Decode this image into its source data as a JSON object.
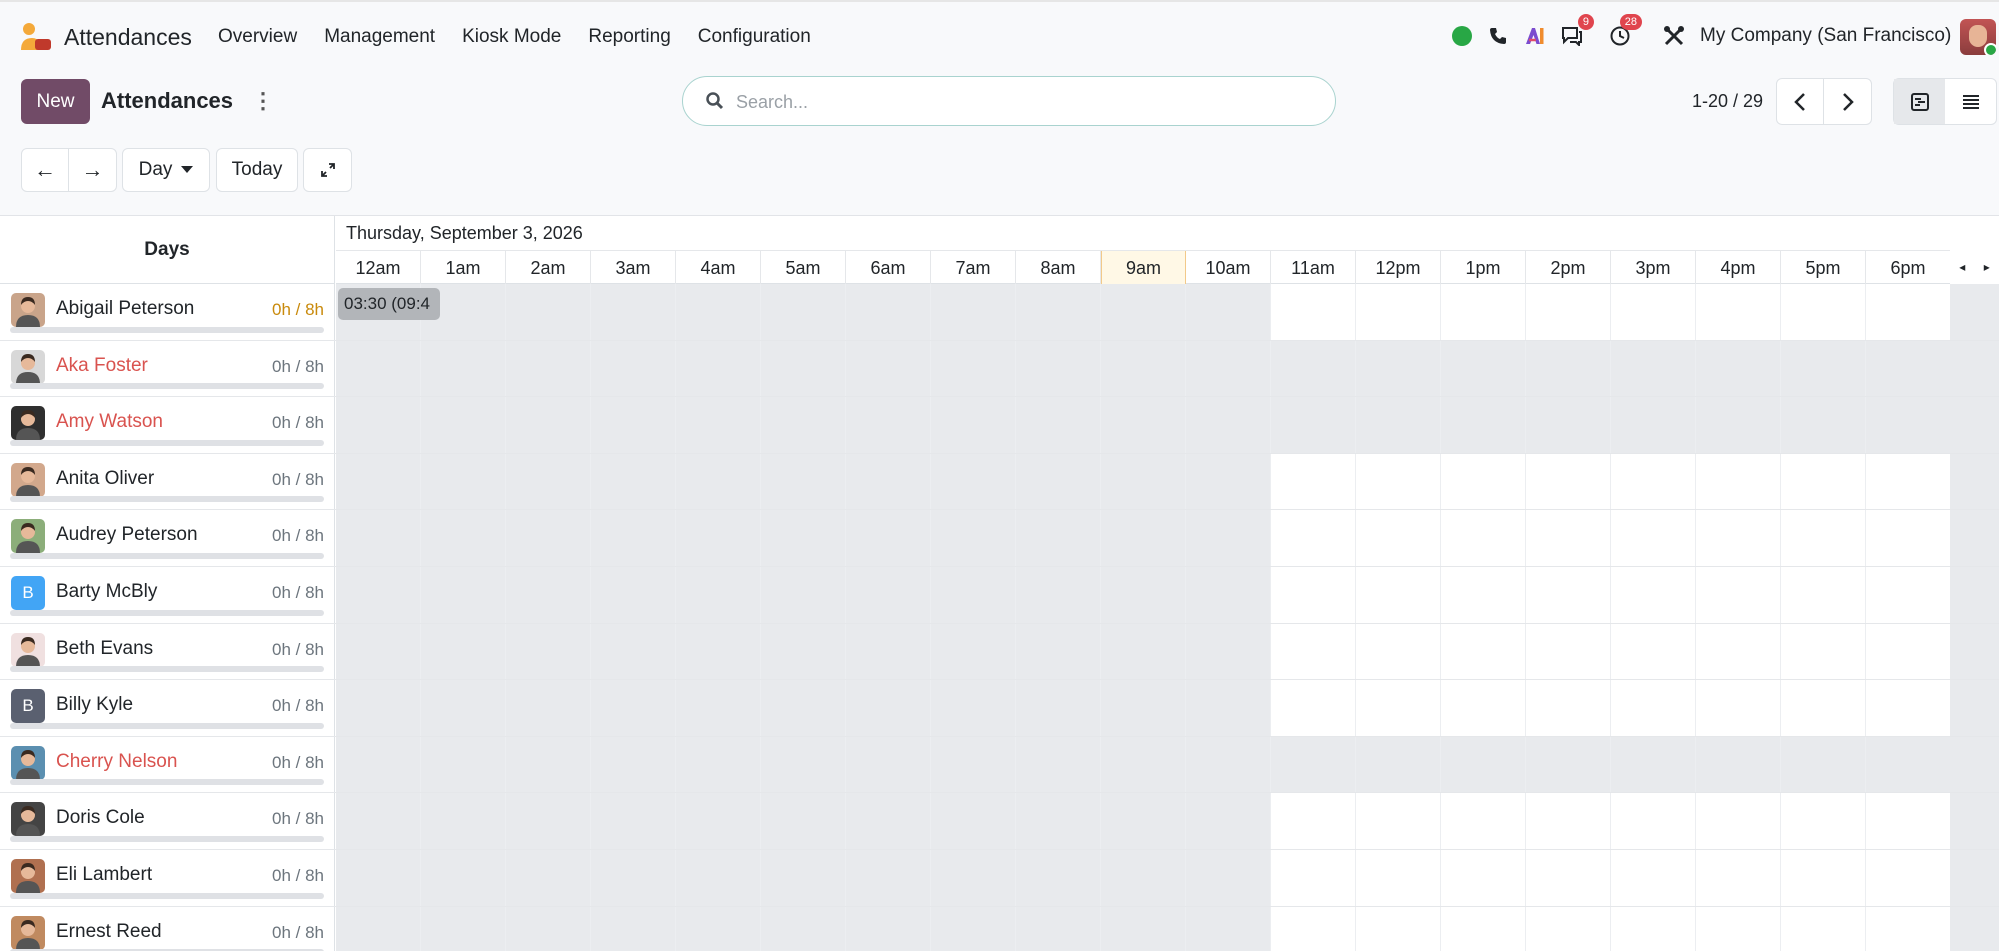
{
  "app": {
    "name": "Attendances"
  },
  "menu": [
    "Overview",
    "Management",
    "Kiosk Mode",
    "Reporting",
    "Configuration"
  ],
  "systray": {
    "messages_count": "9",
    "activities_count": "28",
    "company": "My Company (San Francisco)"
  },
  "control_panel": {
    "new_label": "New",
    "title": "Attendances",
    "search_placeholder": "Search...",
    "pager": "1-20 / 29"
  },
  "toolbar": {
    "scale_label": "Day",
    "today_label": "Today"
  },
  "gantt": {
    "rows_header": "Days",
    "date_label": "Thursday, September 3, 2026",
    "hours": [
      "12am",
      "1am",
      "2am",
      "3am",
      "4am",
      "5am",
      "6am",
      "7am",
      "8am",
      "9am",
      "10am",
      "11am",
      "12pm",
      "1pm",
      "2pm",
      "3pm",
      "4pm",
      "5pm",
      "6pm"
    ],
    "current_hour_index": 9,
    "record_pill": "03:30 (09:4",
    "employees": [
      {
        "name": "Abigail Peterson",
        "hours": "0h / 8h",
        "status": "warn",
        "avatar": "photo",
        "off_until": 11,
        "full_off": false
      },
      {
        "name": "Aka Foster",
        "hours": "0h / 8h",
        "status": "absent",
        "avatar": "photo",
        "off_until": 11,
        "full_off": true
      },
      {
        "name": "Amy Watson",
        "hours": "0h / 8h",
        "status": "absent",
        "avatar": "photo",
        "off_until": 11,
        "full_off": true
      },
      {
        "name": "Anita Oliver",
        "hours": "0h / 8h",
        "status": "normal",
        "avatar": "photo",
        "off_until": 11,
        "full_off": false
      },
      {
        "name": "Audrey Peterson",
        "hours": "0h / 8h",
        "status": "normal",
        "avatar": "photo",
        "off_until": 11,
        "full_off": false
      },
      {
        "name": "Barty McBly",
        "hours": "0h / 8h",
        "status": "normal",
        "avatar": "B",
        "avatar_color": "#42a5f5",
        "off_until": 11,
        "full_off": false
      },
      {
        "name": "Beth Evans",
        "hours": "0h / 8h",
        "status": "normal",
        "avatar": "photo",
        "off_until": 11,
        "full_off": false
      },
      {
        "name": "Billy Kyle",
        "hours": "0h / 8h",
        "status": "normal",
        "avatar": "B",
        "avatar_color": "#5a6070",
        "off_until": 11,
        "full_off": false
      },
      {
        "name": "Cherry Nelson",
        "hours": "0h / 8h",
        "status": "absent",
        "avatar": "photo",
        "off_until": 11,
        "full_off": true
      },
      {
        "name": "Doris Cole",
        "hours": "0h / 8h",
        "status": "normal",
        "avatar": "photo",
        "off_until": 11,
        "full_off": false
      },
      {
        "name": "Eli Lambert",
        "hours": "0h / 8h",
        "status": "normal",
        "avatar": "photo",
        "off_until": 11,
        "full_off": false
      },
      {
        "name": "Ernest Reed",
        "hours": "0h / 8h",
        "status": "normal",
        "avatar": "photo",
        "off_until": 11,
        "full_off": false
      }
    ]
  },
  "colors": {
    "brand": "#714b67",
    "absent_text": "#d9534f",
    "warn_text": "#c98a0c",
    "off_cell": "#e8eaed"
  }
}
